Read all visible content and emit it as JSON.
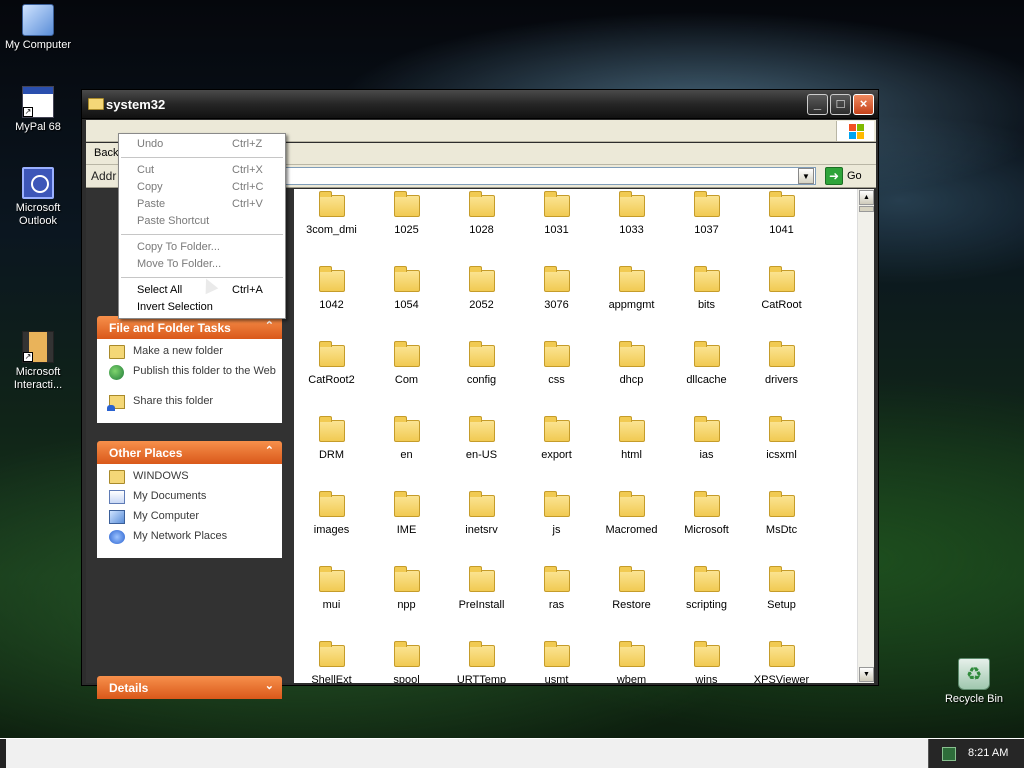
{
  "desktop": {
    "icons": [
      {
        "label": "My Computer",
        "icon": "my-computer-icon"
      },
      {
        "label": "MyPal 68",
        "icon": "mypal-icon"
      },
      {
        "label": "Microsoft Outlook",
        "icon": "outlook-icon"
      },
      {
        "label": "Microsoft Interacti...",
        "icon": "microsoft-interactive-icon"
      },
      {
        "label": "Recycle Bin",
        "icon": "recycle-bin-icon"
      }
    ]
  },
  "window": {
    "title": "system32",
    "toolbar": {
      "back_label": "Back"
    },
    "address": {
      "label": "Addr",
      "value": "",
      "go_label": "Go"
    }
  },
  "context_menu": {
    "items": [
      {
        "label": "Undo",
        "shortcut": "Ctrl+Z",
        "enabled": false
      },
      {
        "label": "Cut",
        "shortcut": "Ctrl+X",
        "enabled": false
      },
      {
        "label": "Copy",
        "shortcut": "Ctrl+C",
        "enabled": false
      },
      {
        "label": "Paste",
        "shortcut": "Ctrl+V",
        "enabled": false
      },
      {
        "label": "Paste Shortcut",
        "shortcut": "",
        "enabled": false
      },
      {
        "label": "Copy To Folder...",
        "shortcut": "",
        "enabled": false
      },
      {
        "label": "Move To Folder...",
        "shortcut": "",
        "enabled": false
      },
      {
        "label": "Select All",
        "shortcut": "Ctrl+A",
        "enabled": true
      },
      {
        "label": "Invert Selection",
        "shortcut": "",
        "enabled": true
      }
    ]
  },
  "tasks": {
    "file_folder": {
      "title": "File and Folder Tasks",
      "items": [
        "Make a new folder",
        "Publish this folder to the Web",
        "Share this folder"
      ]
    },
    "other_places": {
      "title": "Other Places",
      "items": [
        "WINDOWS",
        "My Documents",
        "My Computer",
        "My Network Places"
      ]
    },
    "details": {
      "title": "Details"
    }
  },
  "folders": [
    "3com_dmi",
    "1025",
    "1028",
    "1031",
    "1033",
    "1037",
    "1041",
    "1042",
    "1054",
    "2052",
    "3076",
    "appmgmt",
    "bits",
    "CatRoot",
    "CatRoot2",
    "Com",
    "config",
    "css",
    "dhcp",
    "dllcache",
    "drivers",
    "DRM",
    "en",
    "en-US",
    "export",
    "html",
    "ias",
    "icsxml",
    "images",
    "IME",
    "inetsrv",
    "js",
    "Macromed",
    "Microsoft",
    "MsDtc",
    "mui",
    "npp",
    "PreInstall",
    "ras",
    "Restore",
    "scripting",
    "Setup",
    "ShellExt",
    "spool",
    "URTTemp",
    "usmt",
    "wbem",
    "wins",
    "XPSViewer"
  ],
  "taskbar": {
    "clock": "8:21 AM"
  },
  "colors": {
    "panel_header": "#e8662a",
    "accent_go": "#2fa43a"
  }
}
